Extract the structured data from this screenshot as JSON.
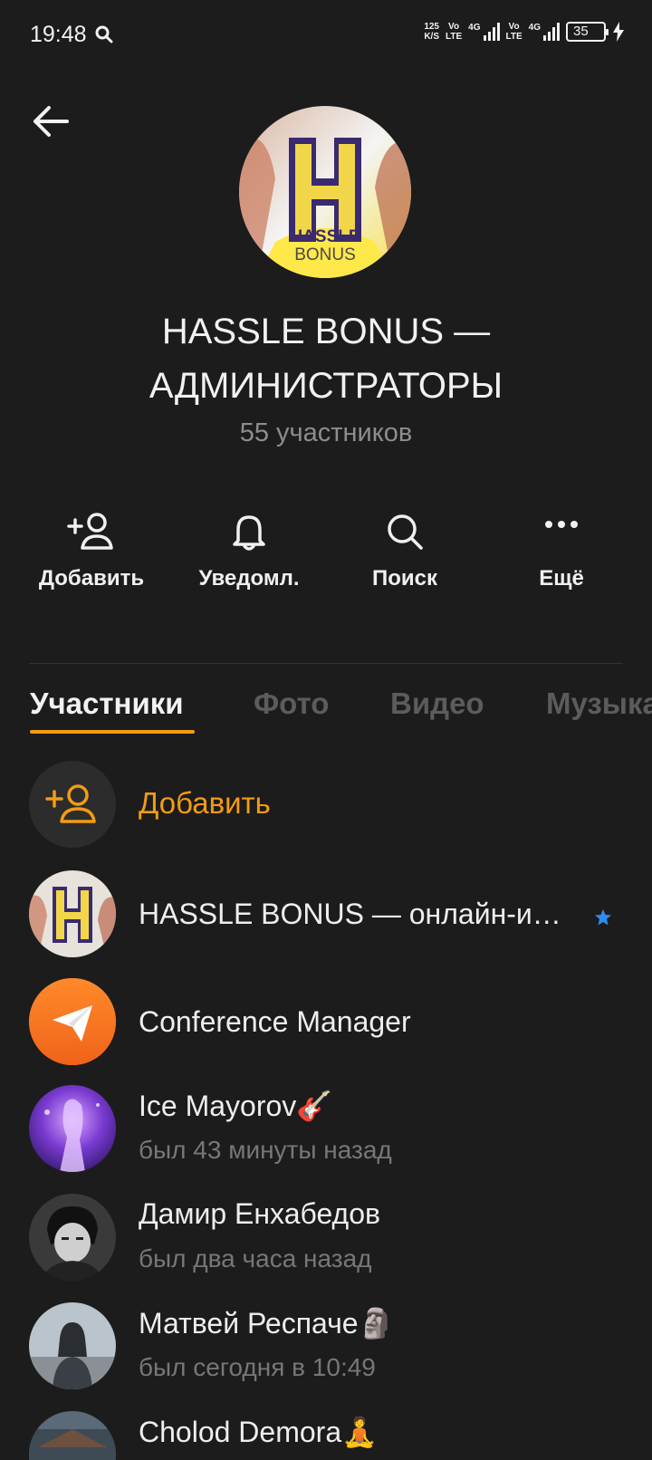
{
  "status_bar": {
    "time": "19:48",
    "net_speed_value": "125",
    "net_speed_unit": "K/S",
    "volte_top": "Vo",
    "volte_bottom": "LTE",
    "sig1_label": "4G",
    "sig2_label": "4G",
    "battery": "35"
  },
  "header": {
    "avatar_text_top": "HASSLE",
    "avatar_text_bottom": "BONUS",
    "avatar_letter": "H",
    "title": "HASSLE BONUS — АДМИНИСТРАТОРЫ",
    "members_count": "55 участников"
  },
  "actions": {
    "add": "Добавить",
    "notifications": "Уведомл.",
    "search": "Поиск",
    "more": "Ещё"
  },
  "tabs": [
    "Участники",
    "Фото",
    "Видео",
    "Музыка"
  ],
  "add_member_label": "Добавить",
  "members": [
    {
      "name": "HASSLE BONUS — онлайн-и…",
      "status": ""
    },
    {
      "name": "Conference Manager",
      "status": ""
    },
    {
      "name": "Ice Mayorov🎸",
      "status": "был 43 минуты назад"
    },
    {
      "name": "Дамир Енхабедов",
      "status": "был два часа назад"
    },
    {
      "name": "Матвей Респаче🗿",
      "status": "был сегодня в 10:49"
    },
    {
      "name": "Cholod Demora🧘",
      "status": ""
    }
  ],
  "colors": {
    "accent": "#f39c12",
    "background": "#1c1c1c",
    "star": "#2f8cf0"
  }
}
